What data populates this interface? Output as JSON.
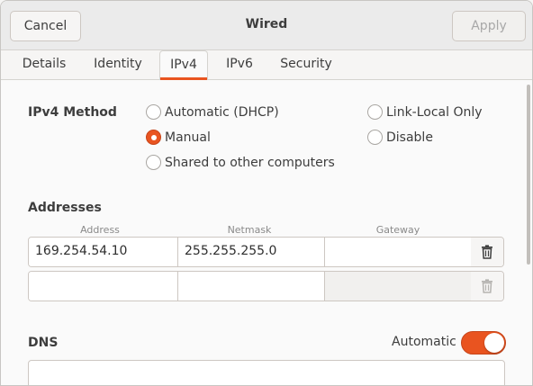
{
  "header": {
    "title": "Wired",
    "cancel_label": "Cancel",
    "apply_label": "Apply"
  },
  "tabs": [
    {
      "label": "Details"
    },
    {
      "label": "Identity"
    },
    {
      "label": "IPv4",
      "active": true
    },
    {
      "label": "IPv6"
    },
    {
      "label": "Security"
    }
  ],
  "ipv4_method": {
    "label": "IPv4 Method",
    "options": [
      {
        "label": "Automatic (DHCP)",
        "checked": false
      },
      {
        "label": "Link-Local Only",
        "checked": false
      },
      {
        "label": "Manual",
        "checked": true
      },
      {
        "label": "Disable",
        "checked": false
      },
      {
        "label": "Shared to other computers",
        "checked": false
      }
    ]
  },
  "addresses": {
    "label": "Addresses",
    "columns": [
      "Address",
      "Netmask",
      "Gateway"
    ],
    "rows": [
      {
        "address": "169.254.54.10",
        "netmask": "255.255.255.0",
        "gateway": ""
      },
      {
        "address": "",
        "netmask": "",
        "gateway": ""
      }
    ]
  },
  "dns": {
    "label": "DNS",
    "automatic_label": "Automatic",
    "automatic_on": true,
    "value": ""
  },
  "colors": {
    "accent": "#e95420"
  },
  "icons": {
    "delete": "trash-icon"
  }
}
